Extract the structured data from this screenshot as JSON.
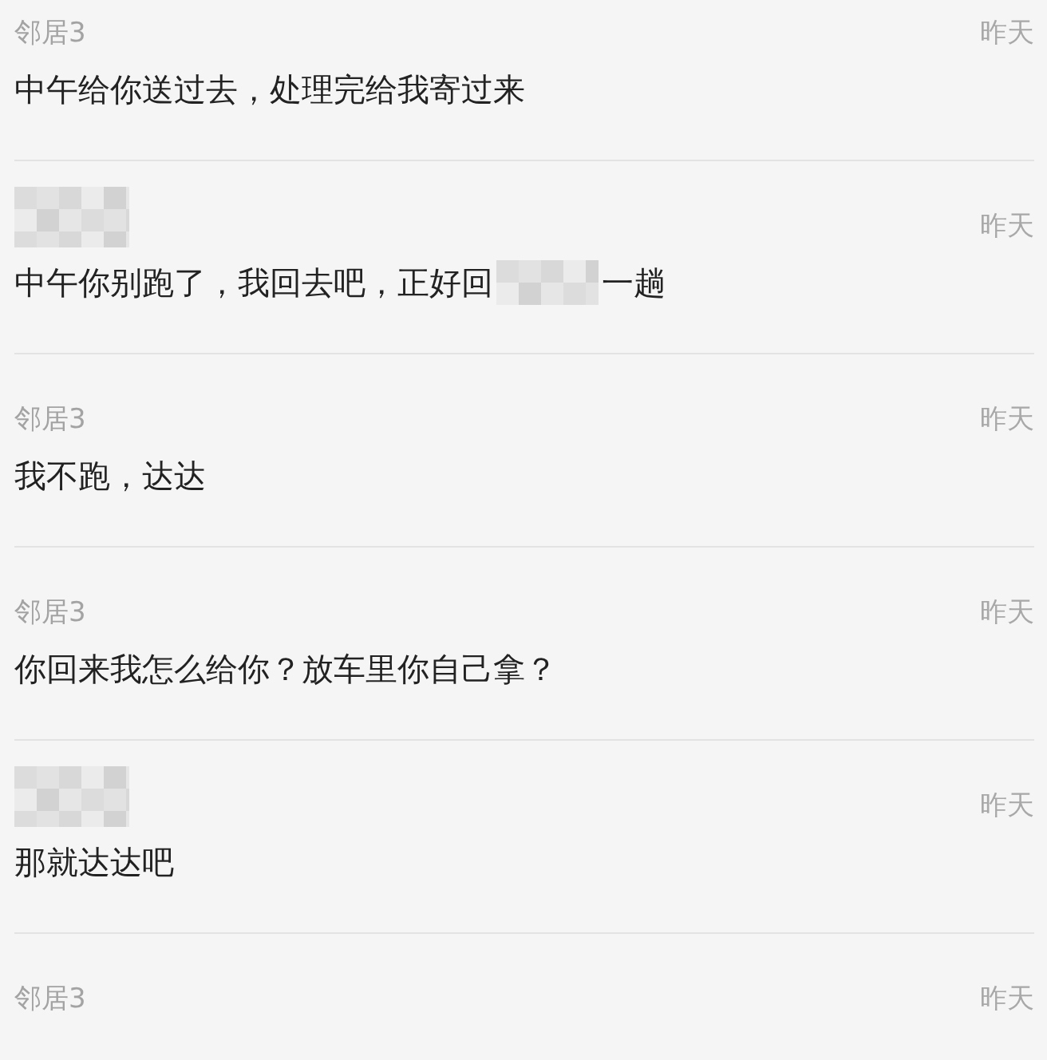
{
  "messages": [
    {
      "sender": {
        "kind": "text",
        "text": "邻居3"
      },
      "time": "昨天",
      "parts": [
        {
          "kind": "text",
          "text": "中午给你送过去，处理完给我寄过来"
        }
      ]
    },
    {
      "sender": {
        "kind": "redacted"
      },
      "time": "昨天",
      "parts": [
        {
          "kind": "text",
          "text": "中午你别跑了，我回去吧，正好回"
        },
        {
          "kind": "redacted"
        },
        {
          "kind": "text",
          "text": "一趟"
        }
      ]
    },
    {
      "sender": {
        "kind": "text",
        "text": "邻居3"
      },
      "time": "昨天",
      "parts": [
        {
          "kind": "text",
          "text": "我不跑，达达"
        }
      ]
    },
    {
      "sender": {
        "kind": "text",
        "text": "邻居3"
      },
      "time": "昨天",
      "parts": [
        {
          "kind": "text",
          "text": "你回来我怎么给你？放车里你自己拿？"
        }
      ]
    },
    {
      "sender": {
        "kind": "redacted"
      },
      "time": "昨天",
      "parts": [
        {
          "kind": "text",
          "text": "那就达达吧"
        }
      ]
    },
    {
      "sender": {
        "kind": "text",
        "text": "邻居3"
      },
      "time": "昨天"
    }
  ]
}
